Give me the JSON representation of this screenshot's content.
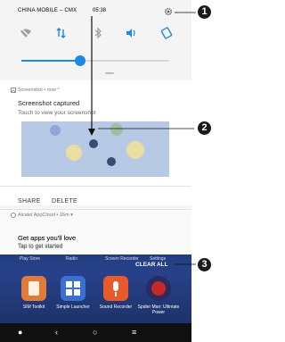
{
  "status": {
    "carrier": "CHINA MOBILE – CMX",
    "time": "05:38"
  },
  "notification1": {
    "header": "Screenshot • now ^",
    "title": "Screenshot captured",
    "subtitle": "Touch to view your screenshot",
    "actions": [
      "SHARE",
      "DELETE"
    ]
  },
  "notification2": {
    "header": "Alcatel AppCloud • 16m ▾",
    "title": "Get apps you'll love",
    "subtitle": "Tap to get started"
  },
  "recents": {
    "dock_labels": [
      "Play Store",
      "Radio",
      "Screen Recorder",
      "Settings"
    ],
    "clear_all": "CLEAR ALL",
    "apps": [
      {
        "label": "SIM Toolkit",
        "icon": "sim-toolkit-icon"
      },
      {
        "label": "Simple Launcher",
        "icon": "simple-launcher-icon"
      },
      {
        "label": "Sound Recorder",
        "icon": "sound-recorder-icon"
      },
      {
        "label": "Spider Man: Ultimate Power",
        "icon": "spiderman-icon"
      }
    ]
  },
  "callouts": [
    "1",
    "2",
    "3"
  ],
  "brightness_level": 0.4,
  "colors": {
    "accent": "#1e88e5",
    "home_bg": "#27418a"
  }
}
